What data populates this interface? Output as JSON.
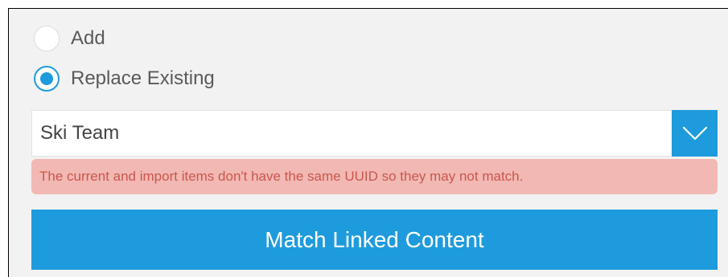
{
  "merge_options": {
    "add_label": "Add",
    "add_selected": false,
    "replace_label": "Replace Existing",
    "replace_selected": true
  },
  "target_select": {
    "value": "Ski Team",
    "toggle_icon": "chevron-down-icon"
  },
  "warning": {
    "text": "The current and import items don't have the same UUID so they may not match."
  },
  "match_button": {
    "label": "Match Linked Content"
  },
  "colors": {
    "accent": "#1e9bdc",
    "warning_bg": "#f2b8b3",
    "warning_text": "#c8574f",
    "panel_bg": "#f2f2f2"
  }
}
